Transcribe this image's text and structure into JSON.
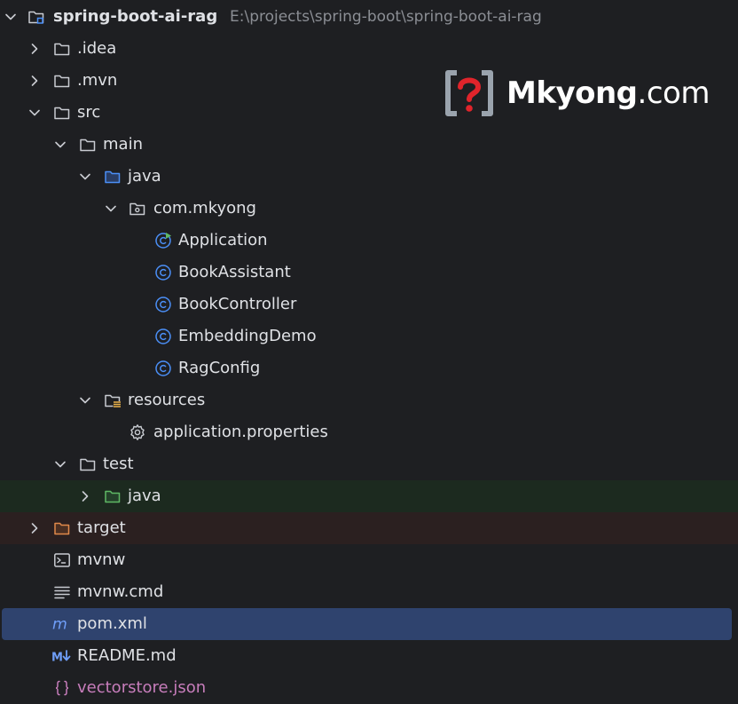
{
  "project": {
    "name": "spring-boot-ai-rag",
    "path": "E:\\projects\\spring-boot\\spring-boot-ai-rag"
  },
  "watermark": {
    "name": "Mkyong",
    "suffix": ".com",
    "icon": "question-brackets-icon"
  },
  "items": {
    "idea": ".idea",
    "mvn": ".mvn",
    "src": "src",
    "main": "main",
    "java": "java",
    "package": "com.mkyong",
    "application": "Application",
    "book_assistant": "BookAssistant",
    "book_controller": "BookController",
    "embedding_demo": "EmbeddingDemo",
    "rag_config": "RagConfig",
    "resources": "resources",
    "app_properties": "application.properties",
    "test": "test",
    "test_java": "java",
    "target": "target",
    "mvnw": "mvnw",
    "mvnw_cmd": "mvnw.cmd",
    "pom": "pom.xml",
    "readme": "README.md",
    "vectorstore": "vectorstore.json"
  },
  "colors": {
    "background": "#1e1f22",
    "selected": "#2f436e",
    "test_source_bg": "#1c2a1f",
    "excluded_bg": "#2b2020",
    "class_icon": "#4b8ff7",
    "run_icon": "#5fb865",
    "excluded_text": "#e0894a",
    "json_text": "#c77dbb"
  }
}
